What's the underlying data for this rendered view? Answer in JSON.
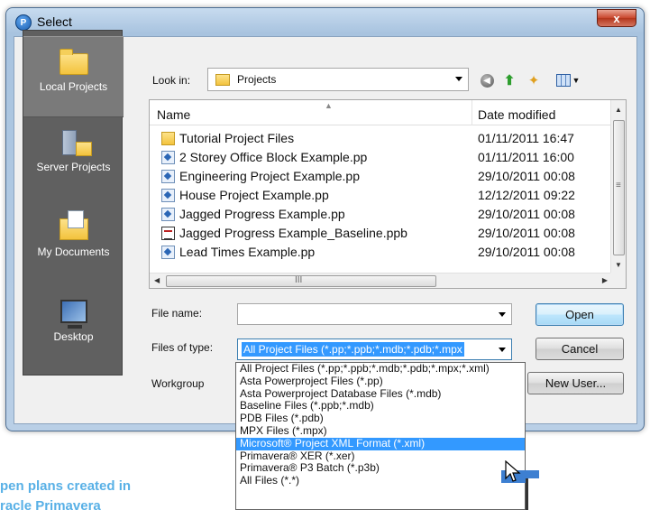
{
  "window": {
    "title": "Select",
    "close_label": "x"
  },
  "places": [
    {
      "label": "Local Projects",
      "icon": "folder-icon"
    },
    {
      "label": "Server Projects",
      "icon": "server-folder-icon"
    },
    {
      "label": "My Documents",
      "icon": "documents-folder-icon"
    },
    {
      "label": "Desktop",
      "icon": "desktop-icon"
    }
  ],
  "lookin": {
    "label": "Look in:",
    "value": "Projects"
  },
  "filelist": {
    "columns": {
      "name": "Name",
      "date": "Date modified"
    },
    "rows": [
      {
        "name": "Tutorial Project Files",
        "date": "01/11/2011 16:47",
        "icon": "folder-icon"
      },
      {
        "name": "2 Storey Office Block Example.pp",
        "date": "01/11/2011 16:00",
        "icon": "pp-file-icon"
      },
      {
        "name": "Engineering Project Example.pp",
        "date": "29/10/2011 00:08",
        "icon": "pp-file-icon"
      },
      {
        "name": "House Project Example.pp",
        "date": "12/12/2011 09:22",
        "icon": "pp-file-icon"
      },
      {
        "name": "Jagged Progress Example.pp",
        "date": "29/10/2011 00:08",
        "icon": "pp-file-icon"
      },
      {
        "name": "Jagged Progress Example_Baseline.ppb",
        "date": "29/10/2011 00:08",
        "icon": "ppb-file-icon"
      },
      {
        "name": "Lead Times Example.pp",
        "date": "29/10/2011 00:08",
        "icon": "pp-file-icon"
      }
    ],
    "hscroll_mark": "III",
    "vscroll_mark": "≡"
  },
  "form": {
    "filename_label": "File name:",
    "filename_value": "",
    "filetype_label": "Files of type:",
    "filetype_value": "All Project Files (*.pp;*.ppb;*.mdb;*.pdb;*.mpx",
    "workgroup_label": "Workgroup",
    "open_label": "Open",
    "cancel_label": "Cancel",
    "newuser_label": "New User..."
  },
  "filetype_options": [
    "All Project Files (*.pp;*.ppb;*.mdb;*.pdb;*.mpx;*.xml)",
    "Asta Powerproject Files (*.pp)",
    "Asta Powerproject Database Files (*.mdb)",
    "Baseline Files (*.ppb;*.mdb)",
    "PDB Files (*.pdb)",
    "MPX Files (*.mpx)",
    "Microsoft® Project XML Format (*.xml)",
    "Primavera® XER (*.xer)",
    "Primavera® P3 Batch (*.p3b)",
    "All Files (*.*)"
  ],
  "highlighted_option_index": 6,
  "caption": {
    "line1": "pen plans created in",
    "line2": "racle Primavera"
  },
  "colors": {
    "accent": "#3399ff",
    "caption": "#58b0e6",
    "places_bg": "#606060"
  }
}
